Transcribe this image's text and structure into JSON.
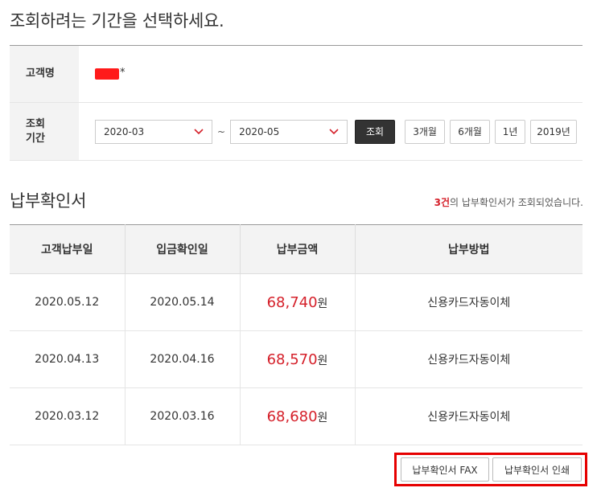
{
  "page": {
    "heading": "조회하려는 기간을 선택하세요."
  },
  "form": {
    "customer_label": "고객명",
    "customer_mask_suffix": "*",
    "period_label_line1": "조회",
    "period_label_line2": "기간",
    "start_value": "2020-03",
    "separator": "~",
    "end_value": "2020-05",
    "search_label": "조회",
    "quick_buttons": [
      "3개월",
      "6개월",
      "1년",
      "2019년"
    ]
  },
  "section": {
    "title": "납부확인서",
    "result_count": "3건",
    "result_text": "의 납부확인서가 조회되었습니다."
  },
  "table": {
    "headers": [
      "고객납부일",
      "입금확인일",
      "납부금액",
      "납부방법"
    ],
    "currency": "원",
    "rows": [
      {
        "pay_date": "2020.05.12",
        "confirm_date": "2020.05.14",
        "amount": "68,740",
        "method": "신용카드자동이체"
      },
      {
        "pay_date": "2020.04.13",
        "confirm_date": "2020.04.16",
        "amount": "68,570",
        "method": "신용카드자동이체"
      },
      {
        "pay_date": "2020.03.12",
        "confirm_date": "2020.03.16",
        "amount": "68,680",
        "method": "신용카드자동이체"
      }
    ]
  },
  "actions": {
    "fax_label": "납부확인서 FAX",
    "print_label": "납부확인서 인쇄"
  },
  "colors": {
    "accent_red": "#d5202a",
    "highlight_border": "#e60000",
    "dark_button": "#333333"
  },
  "icons": {
    "select_arrow": "chevron-down-icon"
  }
}
